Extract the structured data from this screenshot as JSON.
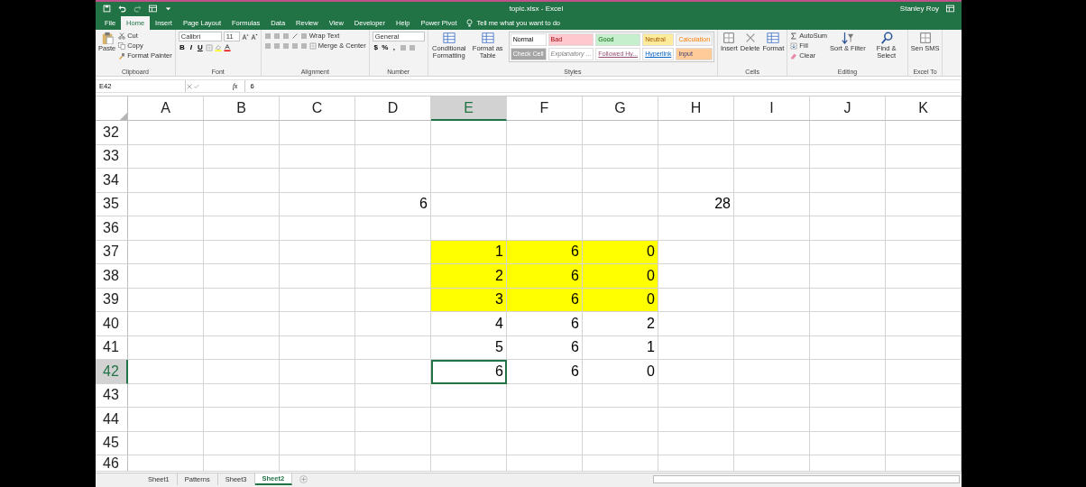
{
  "title_bar": {
    "title": "topic.xlsx - Excel",
    "user": "Stanley Roy"
  },
  "ribbon_tabs": [
    {
      "label": "File",
      "selected": false
    },
    {
      "label": "Home",
      "selected": true
    },
    {
      "label": "Insert",
      "selected": false
    },
    {
      "label": "Page Layout",
      "selected": false
    },
    {
      "label": "Formulas",
      "selected": false
    },
    {
      "label": "Data",
      "selected": false
    },
    {
      "label": "Review",
      "selected": false
    },
    {
      "label": "View",
      "selected": false
    },
    {
      "label": "Developer",
      "selected": false
    },
    {
      "label": "Help",
      "selected": false
    },
    {
      "label": "Power Pivot",
      "selected": false
    }
  ],
  "tell_me": "Tell me what you want to do",
  "ribbon_groups": [
    {
      "kind": "clipboard",
      "label": "Clipboard",
      "large": "Paste",
      "small": [
        "Cut",
        "Copy",
        "Format Painter"
      ]
    },
    {
      "kind": "font",
      "label": "Font",
      "font_name": "Calibri",
      "font_size": "11",
      "buttons": [
        "B",
        "I",
        "U"
      ]
    },
    {
      "kind": "alignment",
      "label": "Alignment",
      "buttons": [
        "Wrap Text",
        "Merge & Center"
      ]
    },
    {
      "kind": "number",
      "label": "Number",
      "format": "General",
      "buttons": [
        "$",
        "%",
        ","
      ]
    },
    {
      "kind": "styles",
      "label": "Styles",
      "large": [
        "Conditional Formatting",
        "Format as Table"
      ],
      "gallery": [
        {
          "label": "Normal",
          "color": "#ffffff",
          "kind": "normal"
        },
        {
          "label": "Bad",
          "color": "#ffc7ce",
          "kind": "bad"
        },
        {
          "label": "Good",
          "color": "#c6efce",
          "kind": "good"
        },
        {
          "label": "Neutral",
          "color": "#ffeb9c",
          "kind": "neutral"
        },
        {
          "label": "Calculation",
          "color": "#f2f2f2",
          "kind": "calculation"
        },
        {
          "label": "Check Cell",
          "color": "#a5a5a5",
          "kind": "check"
        },
        {
          "label": "Explanatory ...",
          "color": "#ffffff",
          "kind": "explanatory"
        },
        {
          "label": "Followed Hy...",
          "color": "#ffffff",
          "kind": "followed"
        },
        {
          "label": "Hyperlink",
          "color": "#ffffff",
          "kind": "hyperlink"
        },
        {
          "label": "Input",
          "color": "#ffcc99",
          "kind": "input"
        }
      ]
    },
    {
      "kind": "large",
      "label": "Cells",
      "buttons": [
        "Insert",
        "Delete",
        "Format"
      ]
    },
    {
      "kind": "editing",
      "label": "Editing",
      "small": [
        "AutoSum",
        "Fill",
        "Clear"
      ],
      "large": [
        "Sort & Filter",
        "Find & Select"
      ]
    },
    {
      "kind": "large",
      "label": "Excel To",
      "buttons": [
        "Sen SMS"
      ]
    }
  ],
  "formula_bar": {
    "name_box": "E42",
    "fx": "fx",
    "value": "6"
  },
  "columns": [
    "A",
    "B",
    "C",
    "D",
    "E",
    "F",
    "G",
    "H",
    "I",
    "J",
    "K"
  ],
  "rows": [
    {
      "label": "32",
      "cells": [
        {},
        {},
        {},
        {},
        {},
        {},
        {},
        {},
        {},
        {},
        {}
      ]
    },
    {
      "label": "33",
      "cells": [
        {},
        {},
        {},
        {},
        {},
        {},
        {},
        {},
        {},
        {},
        {}
      ]
    },
    {
      "label": "34",
      "cells": [
        {},
        {},
        {},
        {},
        {},
        {},
        {},
        {},
        {},
        {},
        {}
      ]
    },
    {
      "label": "35",
      "cells": [
        {},
        {},
        {},
        {
          "value": "6",
          "highlighted": false,
          "selected": false
        },
        {},
        {},
        {},
        {
          "value": "28",
          "highlighted": false,
          "selected": false
        },
        {},
        {},
        {}
      ]
    },
    {
      "label": "36",
      "cells": [
        {},
        {},
        {},
        {},
        {},
        {},
        {},
        {},
        {},
        {},
        {}
      ]
    },
    {
      "label": "37",
      "cells": [
        {},
        {},
        {},
        {},
        {
          "value": "1",
          "highlighted": true,
          "selected": false
        },
        {
          "value": "6",
          "highlighted": true,
          "selected": false
        },
        {
          "value": "0",
          "highlighted": true,
          "selected": false
        },
        {},
        {},
        {},
        {}
      ]
    },
    {
      "label": "38",
      "cells": [
        {},
        {},
        {},
        {},
        {
          "value": "2",
          "highlighted": true,
          "selected": false
        },
        {
          "value": "6",
          "highlighted": true,
          "selected": false
        },
        {
          "value": "0",
          "highlighted": true,
          "selected": false
        },
        {},
        {},
        {},
        {}
      ]
    },
    {
      "label": "39",
      "cells": [
        {},
        {},
        {},
        {},
        {
          "value": "3",
          "highlighted": true,
          "selected": false
        },
        {
          "value": "6",
          "highlighted": true,
          "selected": false
        },
        {
          "value": "0",
          "highlighted": true,
          "selected": false
        },
        {},
        {},
        {},
        {}
      ]
    },
    {
      "label": "40",
      "cells": [
        {},
        {},
        {},
        {},
        {
          "value": "4",
          "highlighted": false,
          "selected": false
        },
        {
          "value": "6",
          "highlighted": false,
          "selected": false
        },
        {
          "value": "2",
          "highlighted": false,
          "selected": false
        },
        {},
        {},
        {},
        {}
      ]
    },
    {
      "label": "41",
      "cells": [
        {},
        {},
        {},
        {},
        {
          "value": "5",
          "highlighted": false,
          "selected": false
        },
        {
          "value": "6",
          "highlighted": false,
          "selected": false
        },
        {
          "value": "1",
          "highlighted": false,
          "selected": false
        },
        {},
        {},
        {},
        {}
      ]
    },
    {
      "label": "42",
      "cells": [
        {},
        {},
        {},
        {},
        {
          "value": "6",
          "highlighted": false,
          "selected": true
        },
        {
          "value": "6",
          "highlighted": false,
          "selected": false
        },
        {
          "value": "0",
          "highlighted": false,
          "selected": false
        },
        {},
        {},
        {},
        {}
      ]
    },
    {
      "label": "43",
      "cells": [
        {},
        {},
        {},
        {},
        {},
        {},
        {},
        {},
        {},
        {},
        {}
      ]
    },
    {
      "label": "44",
      "cells": [
        {},
        {},
        {},
        {},
        {},
        {},
        {},
        {},
        {},
        {},
        {}
      ]
    },
    {
      "label": "45",
      "cells": [
        {},
        {},
        {},
        {},
        {},
        {},
        {},
        {},
        {},
        {},
        {}
      ]
    },
    {
      "label": "46",
      "cells": [
        {},
        {},
        {},
        {},
        {},
        {},
        {},
        {},
        {},
        {},
        {}
      ]
    }
  ],
  "sheet_tabs": [
    {
      "label": "Sheet1",
      "selected": false
    },
    {
      "label": "Patterns",
      "selected": false
    },
    {
      "label": "Sheet3",
      "selected": false
    },
    {
      "label": "Sheet2",
      "selected": true
    }
  ]
}
